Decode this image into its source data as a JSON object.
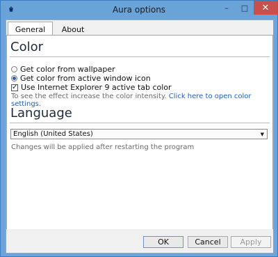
{
  "window": {
    "title": "Aura options",
    "controls": {
      "minimize": "–",
      "maximize": "□",
      "close": "✕"
    }
  },
  "tabs": [
    {
      "label": "General",
      "selected": true
    },
    {
      "label": "About",
      "selected": false
    }
  ],
  "color": {
    "title": "Color",
    "options": [
      {
        "label": "Get color from wallpaper",
        "selected": false
      },
      {
        "label": "Get color from active window icon",
        "selected": true
      }
    ],
    "ie_checkbox": {
      "label": "Use Internet Explorer 9 active tab color",
      "checked": true
    },
    "hint_text": "To see the effect increase the color intensity.",
    "hint_link": "Click here to open color settings."
  },
  "language": {
    "title": "Language",
    "selected": "English (United States)",
    "note": "Changes will be applied after restarting the program"
  },
  "buttons": {
    "ok": "OK",
    "cancel": "Cancel",
    "apply": "Apply"
  },
  "colors": {
    "accent": "#1f5fbf",
    "title_bar": "#6aa3d8",
    "close_button": "#c7504a"
  }
}
